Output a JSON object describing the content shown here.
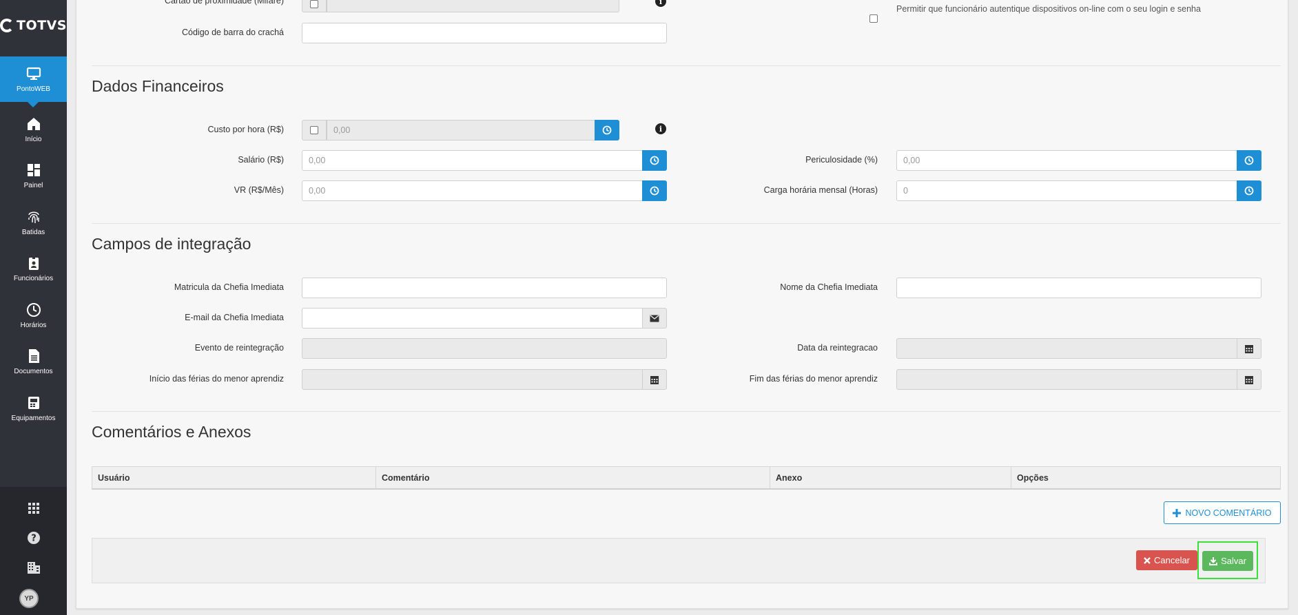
{
  "brand": {
    "logo_text": "TOTVS"
  },
  "sidebar": {
    "items": [
      {
        "label": "PontoWEB",
        "icon": "monitor-icon"
      },
      {
        "label": "Início",
        "icon": "home-icon"
      },
      {
        "label": "Painel",
        "icon": "dashboard-icon"
      },
      {
        "label": "Batidas",
        "icon": "fingerprint-icon"
      },
      {
        "label": "Funcionários",
        "icon": "badge-icon"
      },
      {
        "label": "Horários",
        "icon": "clock-icon"
      },
      {
        "label": "Documentos",
        "icon": "document-icon"
      },
      {
        "label": "Equipamentos",
        "icon": "device-icon"
      }
    ],
    "bottom_icons": [
      "apps-grid-icon",
      "help-icon",
      "building-icon"
    ],
    "avatar_initials": "YP"
  },
  "top": {
    "cartao_label": "Cartão de proximidade (Mifare)",
    "codigo_label": "Código de barra do crachá",
    "codigo_value": "",
    "permitir_label": "Permitir que funcionário autentique dispositivos on-line com o seu login e senha"
  },
  "financeiro": {
    "title": "Dados Financeiros",
    "custo_label": "Custo por hora (R$)",
    "custo_value": "0,00",
    "salario_label": "Salário (R$)",
    "salario_value": "0,00",
    "vr_label": "VR (R$/Mês)",
    "vr_value": "0,00",
    "periculosidade_label": "Periculosidade (%)",
    "periculosidade_value": "0,00",
    "carga_label": "Carga horária mensal (Horas)",
    "carga_value": "0"
  },
  "integracao": {
    "title": "Campos de integração",
    "matricula_label": "Matricula da Chefia Imediata",
    "nome_label": "Nome da Chefia Imediata",
    "email_label": "E-mail da Chefia Imediata",
    "evento_label": "Evento de reintegração",
    "data_reint_label": "Data da reintegracao",
    "inicio_ferias_label": "Início das férias do menor aprendiz",
    "fim_ferias_label": "Fim das férias do menor aprendiz"
  },
  "comentarios": {
    "title": "Comentários e Anexos",
    "columns": [
      "Usuário",
      "Comentário",
      "Anexo",
      "Opções"
    ],
    "novo_label": "NOVO COMENTÁRIO"
  },
  "actions": {
    "cancelar_label": "Cancelar",
    "salvar_label": "Salvar"
  },
  "colors": {
    "accent": "#1e8fd5",
    "sidebar": "#2f3238",
    "danger": "#d9534f",
    "success": "#5cb85c",
    "highlight": "#38e038"
  }
}
